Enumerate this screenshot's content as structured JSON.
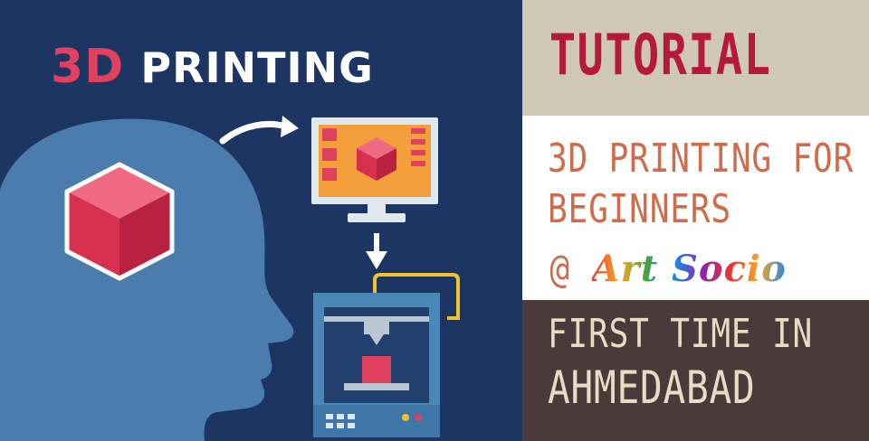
{
  "graphic": {
    "title_3d": "3D",
    "title_printing": "PRINTING"
  },
  "panel": {
    "header": "TUTORIAL",
    "course_line1": "3D PRINTING FOR",
    "course_line2": "BEGINNERS",
    "at_symbol": "@",
    "brand": "Art Socio",
    "footer_line1": "FIRST TIME IN",
    "footer_line2": "AHMEDABAD"
  },
  "icons": [
    "head-silhouette-icon",
    "cube-icon",
    "curved-arrow-icon",
    "monitor-icon",
    "down-arrow-icon",
    "3d-printer-icon"
  ],
  "colors": {
    "navy": "#1d3563",
    "head": "#4a7dad",
    "cube": "#e0415e",
    "title_red": "#b5193b",
    "accent_orange": "#cf6c4b",
    "beige": "#cfc8b4",
    "dark_brown": "#4a3b3a",
    "cream": "#e8dcc4"
  }
}
